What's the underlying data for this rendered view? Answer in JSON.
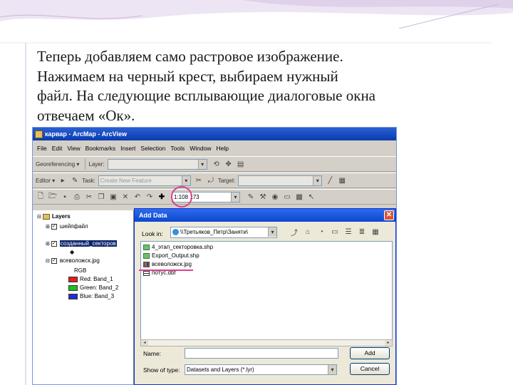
{
  "slide": {
    "lines": [
      "Теперь добавляем само растровое изображение.",
      "Нажимаем на черный крест, выбираем нужный",
      "файл. На следующие всплывающие диалоговые окна",
      "отвечаем «Ок»."
    ]
  },
  "arcmap": {
    "title": "карвар - ArcMap - ArcView",
    "menu": [
      "File",
      "Edit",
      "View",
      "Bookmarks",
      "Insert",
      "Selection",
      "Tools",
      "Window",
      "Help"
    ],
    "georef_label": "Georeferencing ▾",
    "layer_label": "Layer:",
    "editor_label": "Editor ▾",
    "task_label": "Task:",
    "task_value": "Create New Feature",
    "target_label": "Target:",
    "scale_value": "1:108 173",
    "toc": {
      "root": "Layers",
      "layers": [
        "шейпфайл",
        "созданный_секторов",
        "всеволожск.jpg"
      ],
      "rgb_label": "RGB",
      "bands": [
        {
          "label": "Red:   Band_1",
          "color": "#e02020"
        },
        {
          "label": "Green: Band_2",
          "color": "#20c020"
        },
        {
          "label": "Blue:  Band_3",
          "color": "#2030d0"
        }
      ]
    }
  },
  "dialog": {
    "title": "Add Data",
    "look_in_label": "Look in:",
    "look_in_value": "\\\\Третьяков_Петр\\Заняти\\",
    "files": [
      {
        "name": "4_этап_секторовка.shp",
        "type": "shape"
      },
      {
        "name": "Export_Output.shp",
        "type": "shape"
      },
      {
        "name": "всеволожск.jpg",
        "type": "raster"
      },
      {
        "name": "потус.dbf",
        "type": "table"
      }
    ],
    "name_label": "Name:",
    "name_value": "",
    "type_label": "Show of type:",
    "type_value": "Datasets and Layers (*.lyr)",
    "add_button": "Add",
    "cancel_button": "Cancel"
  },
  "colors": {
    "highlight_circle": "#e0408a",
    "xp_title": "#0b48d0"
  }
}
